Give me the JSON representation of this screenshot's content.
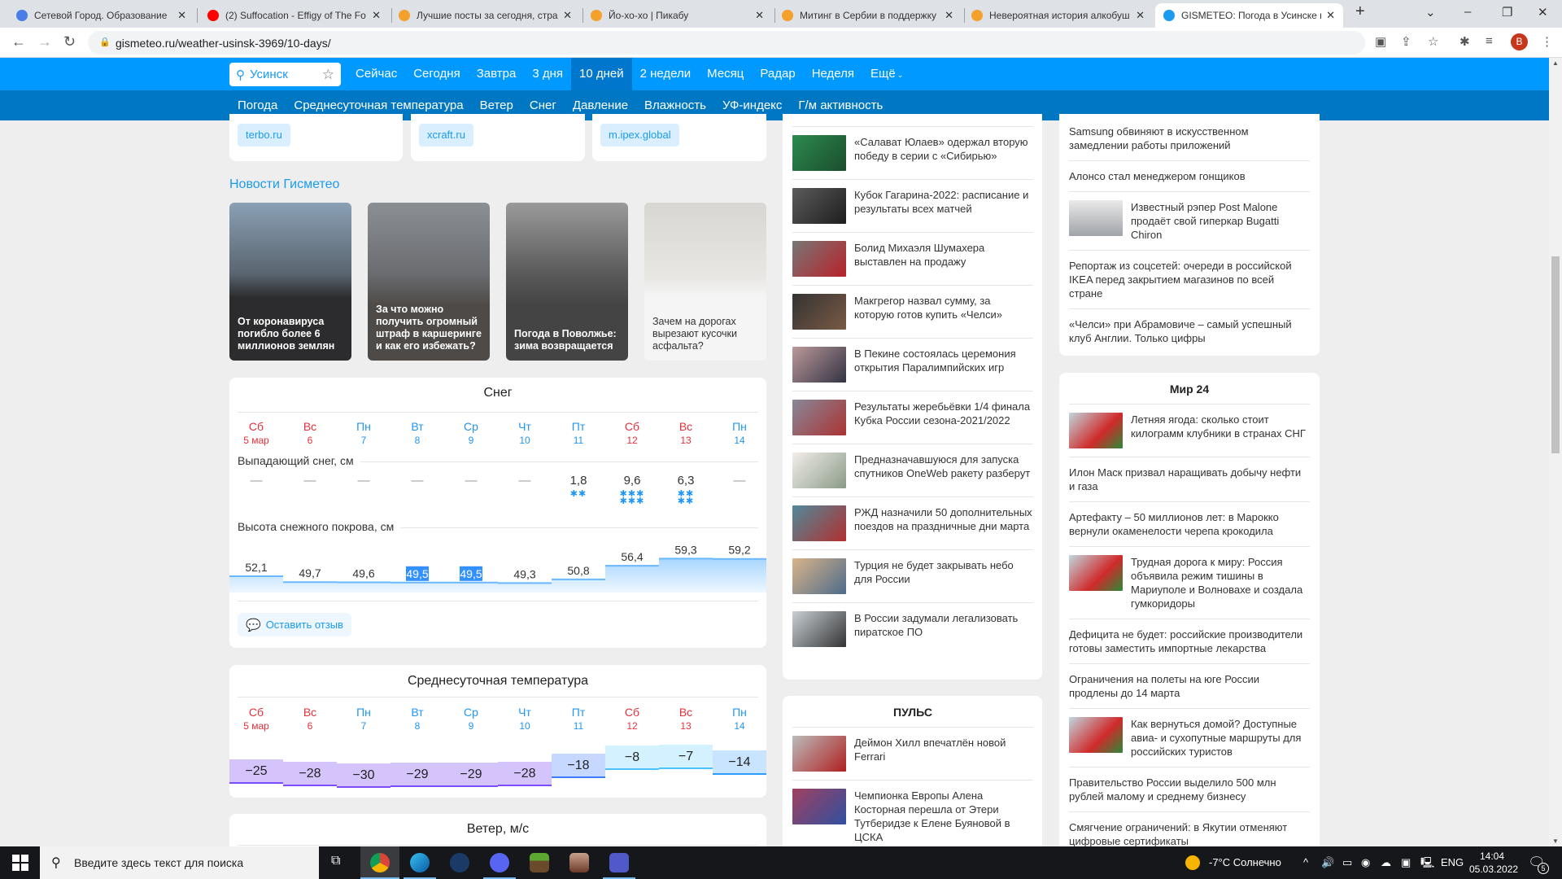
{
  "browser": {
    "tabs": [
      {
        "title": "Сетевой Город. Образование",
        "icon": "netcity-icon",
        "color": "#4a7ee6"
      },
      {
        "title": "(2) Suffocation - Effigy of The Fo",
        "icon": "youtube-icon",
        "color": "#ff0000"
      },
      {
        "title": "Лучшие посты за сегодня, стра",
        "icon": "pikabu-icon",
        "color": "#f4a02c"
      },
      {
        "title": "Йо-хо-хо | Пикабу",
        "icon": "pikabu-icon",
        "color": "#f4a02c"
      },
      {
        "title": "Митинг в Сербии в поддержку",
        "icon": "pikabu-icon",
        "color": "#f4a02c"
      },
      {
        "title": "Невероятная история алкобуш",
        "icon": "pikabu-icon",
        "color": "#f4a02c"
      },
      {
        "title": "GISMETEO: Погода в Усинске н",
        "icon": "gismeteo-drop-icon",
        "color": "#1a9bf0",
        "active": true
      }
    ],
    "new_tab": "+",
    "url": "gismeteo.ru/weather-usinsk-3969/10-days/",
    "profile_initial": "B"
  },
  "site": {
    "search_value": "Усинск",
    "nav": [
      "Сейчас",
      "Сегодня",
      "Завтра",
      "3 дня",
      "10 дней",
      "2 недели",
      "Месяц",
      "Радар",
      "Неделя",
      "Ещё"
    ],
    "nav_active": "10 дней",
    "subnav": [
      "Погода",
      "Среднесуточная температура",
      "Ветер",
      "Снег",
      "Давление",
      "Влажность",
      "УФ-индекс",
      "Г/м активность"
    ],
    "colors": {
      "nav": "#0099ff",
      "subnav": "#0077c2",
      "accent": "#1a9bf0",
      "weekend": "#e8303a",
      "weekday": "#2196f3"
    }
  },
  "ads": [
    "terbo.ru",
    "xcraft.ru",
    "m.ipex.global"
  ],
  "news": {
    "title": "Новости Гисметео",
    "cards": [
      "От коронавируса погибло более 6 миллионов землян",
      "За что можно получить огромный штраф в каршеринге и как его избежать?",
      "Погода в Поволжье: зима возвращается",
      "Зачем на дорогах вырезают кусочки асфальта?"
    ]
  },
  "days": [
    {
      "dow": "Сб",
      "date": "5 мар",
      "weekend": true
    },
    {
      "dow": "Вс",
      "date": "6",
      "weekend": true
    },
    {
      "dow": "Пн",
      "date": "7",
      "weekend": false
    },
    {
      "dow": "Вт",
      "date": "8",
      "weekend": false
    },
    {
      "dow": "Ср",
      "date": "9",
      "weekend": false
    },
    {
      "dow": "Чт",
      "date": "10",
      "weekend": false
    },
    {
      "dow": "Пт",
      "date": "11",
      "weekend": false
    },
    {
      "dow": "Сб",
      "date": "12",
      "weekend": true
    },
    {
      "dow": "Вс",
      "date": "13",
      "weekend": true
    },
    {
      "dow": "Пн",
      "date": "14",
      "weekend": false
    }
  ],
  "snow": {
    "title": "Снег",
    "falling_label": "Выпадающий снег, см",
    "falling": [
      "—",
      "—",
      "—",
      "—",
      "—",
      "—",
      "1,8",
      "9,6",
      "6,3",
      "—"
    ],
    "snowflake_icons": [
      0,
      0,
      0,
      0,
      0,
      0,
      2,
      6,
      4,
      0
    ],
    "cover_label": "Высота снежного покрова, см",
    "cover": [
      "52,1",
      "49,7",
      "49,6",
      "49,5",
      "49,5",
      "49,3",
      "50,8",
      "56,4",
      "59,3",
      "59,2"
    ],
    "selected_cells": [
      3,
      4
    ],
    "feedback": "Оставить отзыв"
  },
  "temperature": {
    "title": "Среднесуточная температура",
    "values": [
      "−25",
      "−28",
      "−30",
      "−29",
      "−29",
      "−28",
      "−18",
      "−8",
      "−7",
      "−14"
    ]
  },
  "wind": {
    "title": "Ветер, м/с"
  },
  "middle_news": [
    "«Салават Юлаев» одержал вторую победу в серии с «Сибирью»",
    "Кубок Гагарина-2022: расписание и результаты всех матчей",
    "Болид Михаэля Шумахера выставлен на продажу",
    "Макгрегор назвал сумму, за которую готов купить «Челси»",
    "В Пекине состоялась церемония открытия Паралимпийских игр",
    "Результаты жеребьёвки 1/4 финала Кубка России сезона-2021/2022",
    "Предназначавшуюся для запуска спутников OneWeb ракету разберут",
    "РЖД назначили 50 дополнительных поездов на праздничные дни марта",
    "Турция не будет закрывать небо для России",
    "В России задумали легализовать пиратское ПО"
  ],
  "pulse": {
    "title": "ПУЛЬС",
    "items": [
      "Деймон Хилл впечатлён новой Ferrari",
      "Чемпионка Европы Алена Косторная перешла от Этери Тутберидзе к Елене Буяновой в ЦСКА"
    ]
  },
  "right_news": [
    {
      "text": "Samsung обвиняют в искусственном замедлении работы приложений",
      "img": false
    },
    {
      "text": "Алонсо стал менеджером гонщиков",
      "img": false
    },
    {
      "text": "Известный рэпер Post Malone продаёт свой гиперкар Bugatti Chiron",
      "img": true
    },
    {
      "text": "Репортаж из соцсетей: очереди в российской IKEA перед закрытием магазинов по всей стране",
      "img": false
    },
    {
      "text": "«Челси» при Абрамовиче – самый успешный клуб Англии. Только цифры",
      "img": false
    }
  ],
  "mir24": {
    "title": "Мир 24",
    "items": [
      {
        "text": "Летняя ягода: сколько стоит килограмм клубники в странах СНГ",
        "img": true
      },
      {
        "text": "Илон Маск призвал наращивать добычу нефти и газа",
        "img": false
      },
      {
        "text": "Артефакту – 50 миллионов лет: в Марокко вернули окаменелости черепа крокодила",
        "img": false
      },
      {
        "text": "Трудная дорога к миру: Россия объявила режим тишины в Мариуполе и Волновахе и создала гумкоридоры",
        "img": true
      },
      {
        "text": "Дефицита не будет: российские производители готовы заместить импортные лекарства",
        "img": false
      },
      {
        "text": "Ограничения на полеты на юге России продлены до 14 марта",
        "img": false
      },
      {
        "text": "Как вернуться домой? Доступные авиа- и сухопутные маршруты для российских туристов",
        "img": true
      },
      {
        "text": "Правительство России выделило 500 млн рублей малому и среднему бизнесу",
        "img": false
      },
      {
        "text": "Смягчение ограничений: в Якутии отменяют цифровые сертификаты",
        "img": false
      }
    ]
  },
  "taskbar": {
    "search_placeholder": "Введите здесь текст для поиска",
    "weather": "-7°C  Солнечно",
    "lang": "ENG",
    "time": "14:04",
    "date": "05.03.2022",
    "notifications": "5"
  }
}
